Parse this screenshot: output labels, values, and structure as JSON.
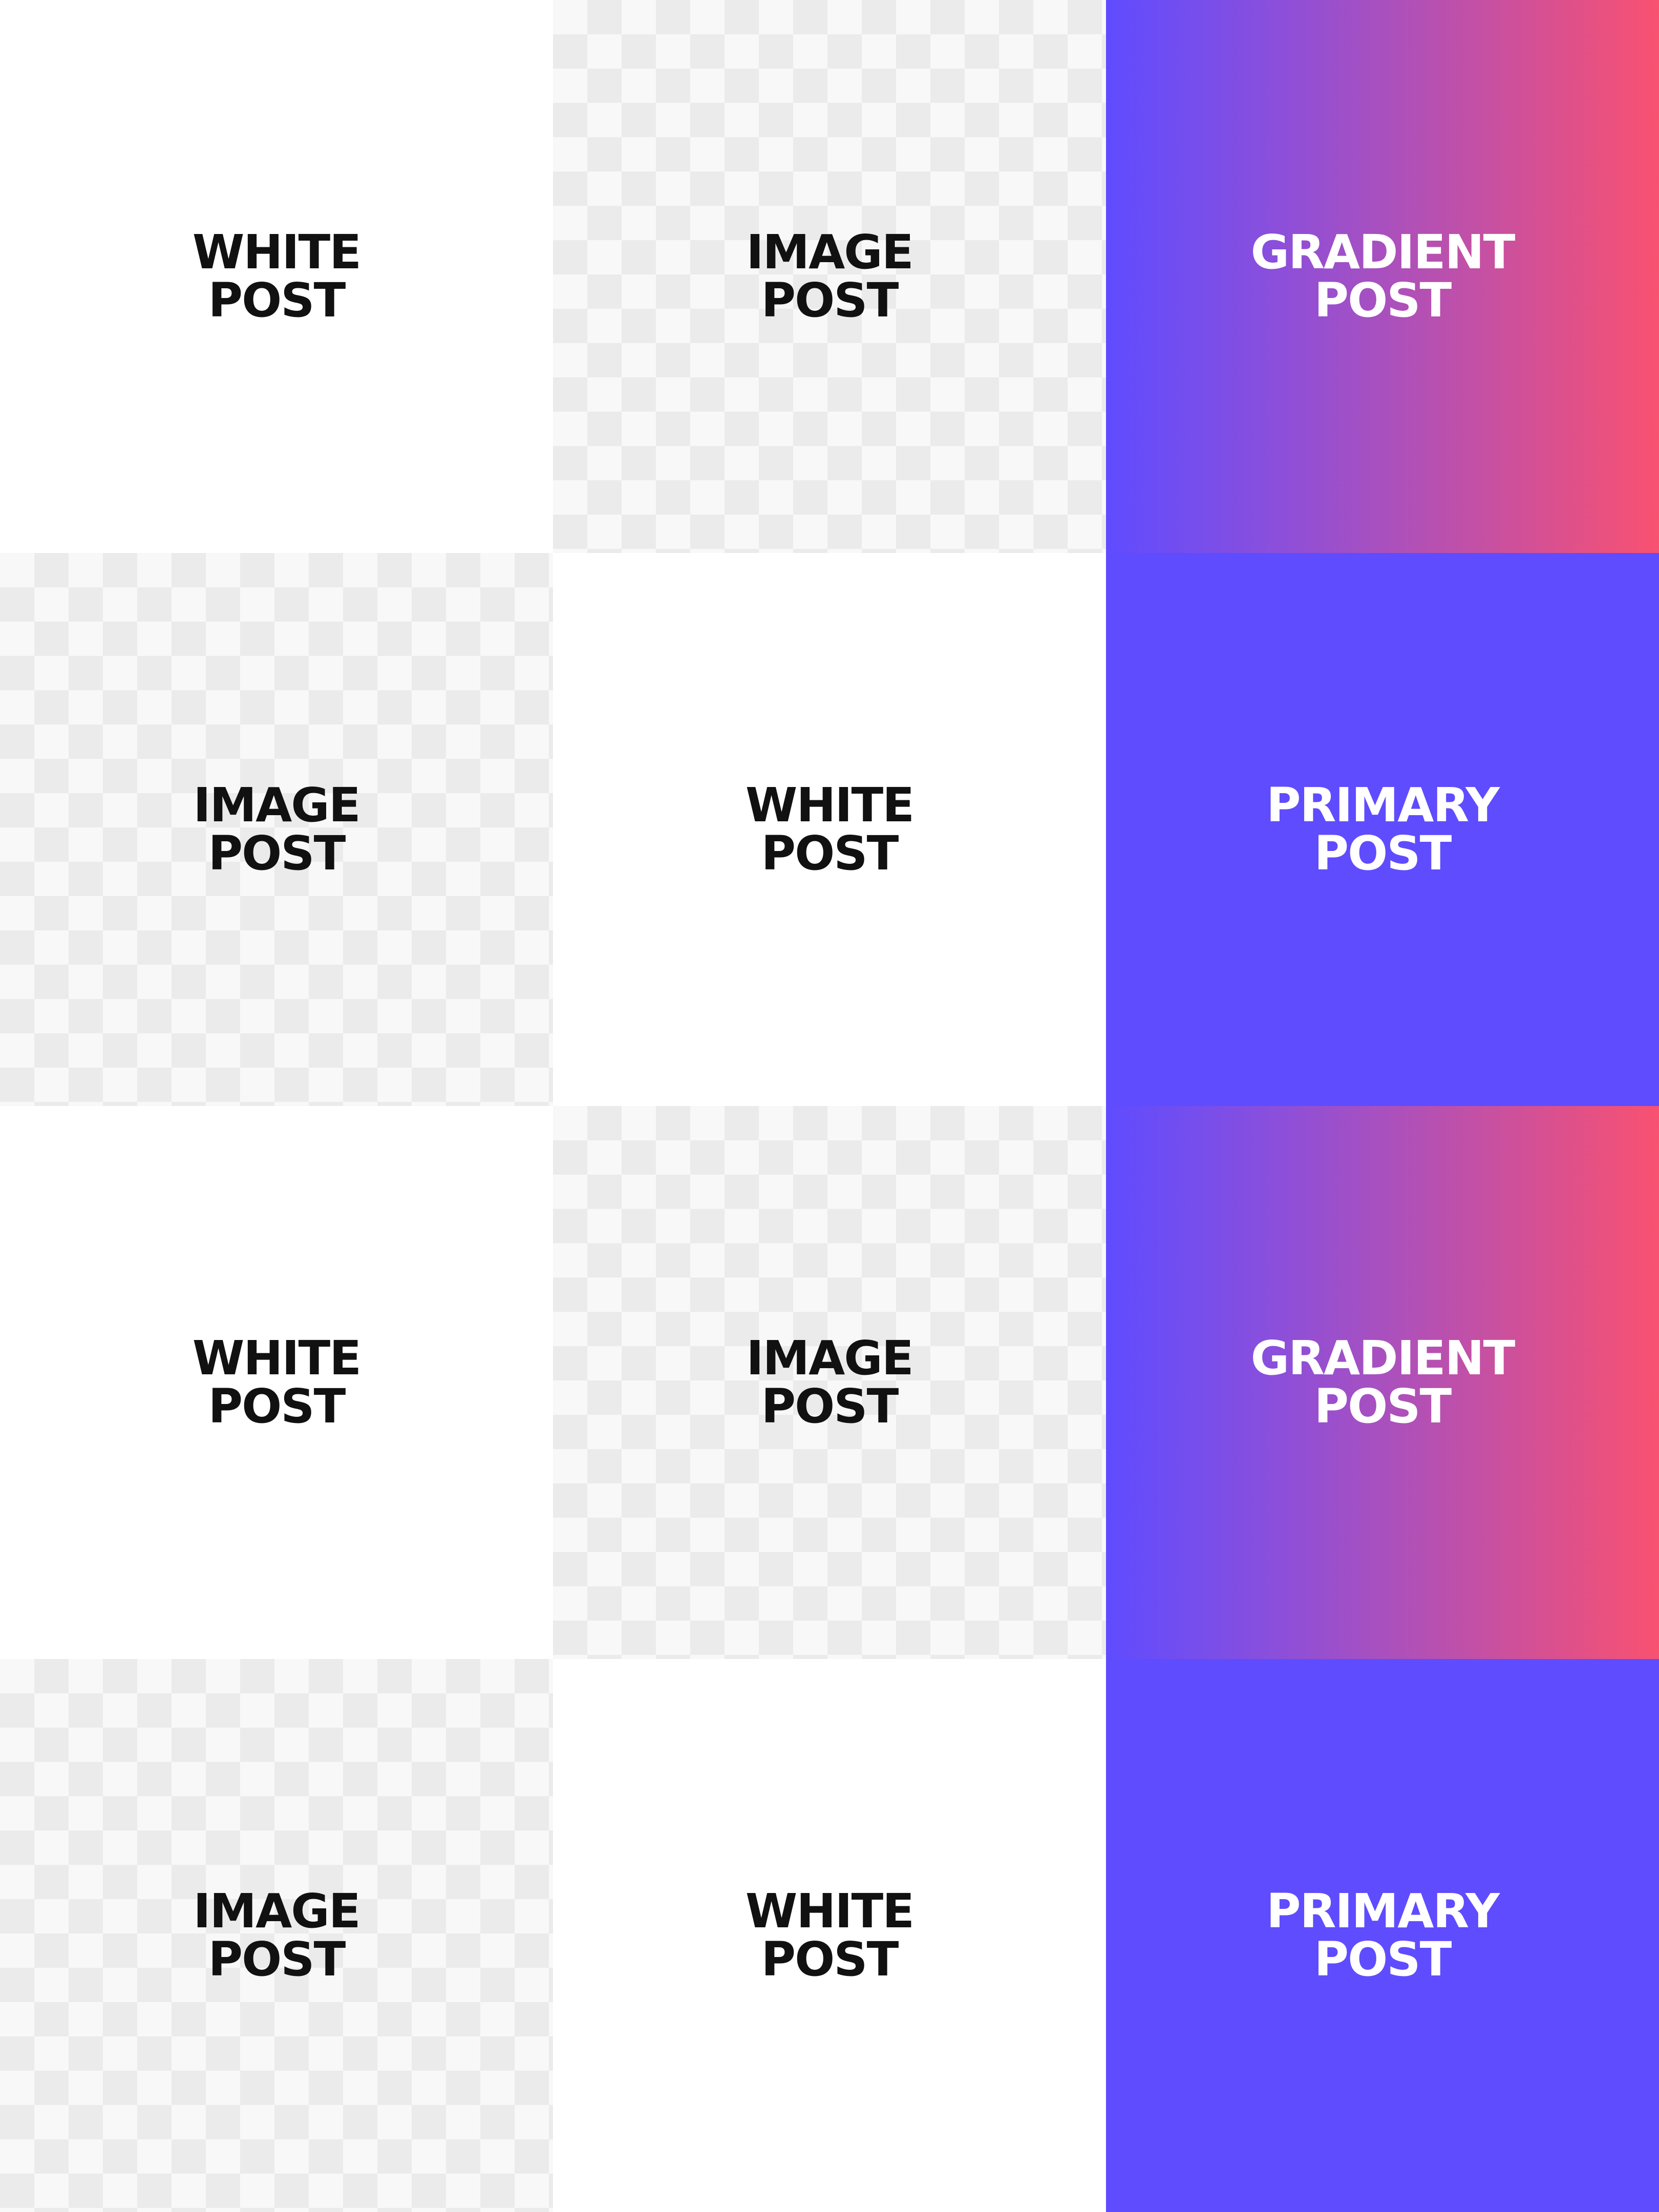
{
  "colors": {
    "white": "#ffffff",
    "checker_light": "#f8f8f8",
    "checker_dark": "#ebebeb",
    "primary": "#5f4cff",
    "gradient_start": "#5f4cff",
    "gradient_end": "#f95170",
    "dark_text": "#111111",
    "light_text": "#ffffff"
  },
  "tiles": [
    {
      "line1": "WHITE",
      "line2": "POST",
      "style": "white"
    },
    {
      "line1": "IMAGE",
      "line2": "POST",
      "style": "image"
    },
    {
      "line1": "GRADIENT",
      "line2": "POST",
      "style": "gradient"
    },
    {
      "line1": "IMAGE",
      "line2": "POST",
      "style": "image"
    },
    {
      "line1": "WHITE",
      "line2": "POST",
      "style": "white"
    },
    {
      "line1": "PRIMARY",
      "line2": "POST",
      "style": "primary"
    },
    {
      "line1": "WHITE",
      "line2": "POST",
      "style": "white"
    },
    {
      "line1": "IMAGE",
      "line2": "POST",
      "style": "image"
    },
    {
      "line1": "GRADIENT",
      "line2": "POST",
      "style": "gradient"
    },
    {
      "line1": "IMAGE",
      "line2": "POST",
      "style": "image"
    },
    {
      "line1": "WHITE",
      "line2": "POST",
      "style": "white"
    },
    {
      "line1": "PRIMARY",
      "line2": "POST",
      "style": "primary"
    }
  ]
}
